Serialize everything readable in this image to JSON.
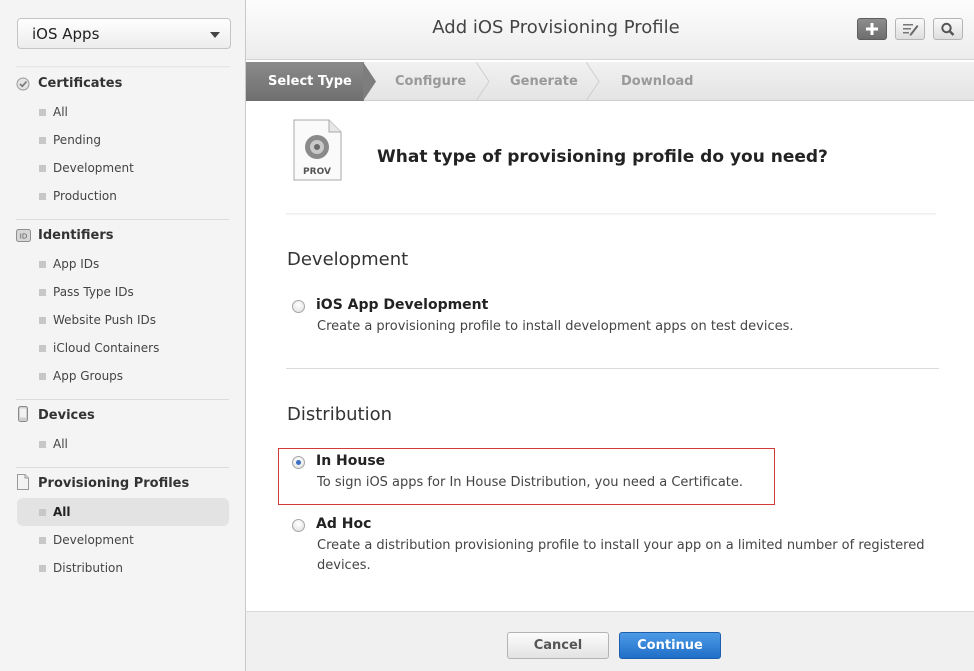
{
  "sidebar": {
    "app_select": "iOS Apps",
    "sections": [
      {
        "title": "Certificates",
        "icon": "certificate-icon",
        "items": [
          "All",
          "Pending",
          "Development",
          "Production"
        ]
      },
      {
        "title": "Identifiers",
        "icon": "id-badge-icon",
        "badge_text": "ID",
        "items": [
          "App IDs",
          "Pass Type IDs",
          "Website Push IDs",
          "iCloud Containers",
          "App Groups"
        ]
      },
      {
        "title": "Devices",
        "icon": "device-icon",
        "items": [
          "All"
        ]
      },
      {
        "title": "Provisioning Profiles",
        "icon": "document-icon",
        "items": [
          "All",
          "Development",
          "Distribution"
        ],
        "selected": "All"
      }
    ]
  },
  "header": {
    "title": "Add iOS Provisioning Profile",
    "buttons": [
      "plus-icon",
      "edit-icon",
      "search-icon"
    ]
  },
  "steps": [
    "Select Type",
    "Configure",
    "Generate",
    "Download"
  ],
  "content": {
    "file_icon_label": "PROV",
    "question": "What type of provisioning profile do you need?",
    "development": {
      "title": "Development",
      "options": [
        {
          "title": "iOS App Development",
          "desc": "Create a provisioning profile to install development apps on test devices.",
          "checked": false
        }
      ]
    },
    "distribution": {
      "title": "Distribution",
      "options": [
        {
          "title": "In House",
          "desc": "To sign iOS apps for In House Distribution, you need a Certificate.",
          "checked": true
        },
        {
          "title": "Ad Hoc",
          "desc": "Create a distribution provisioning profile to install your app on a limited number of registered devices.",
          "checked": false
        }
      ]
    }
  },
  "footer": {
    "cancel": "Cancel",
    "continue": "Continue"
  },
  "colors": {
    "accent": "#1f6fc8",
    "highlight_border": "#d23a3a"
  }
}
